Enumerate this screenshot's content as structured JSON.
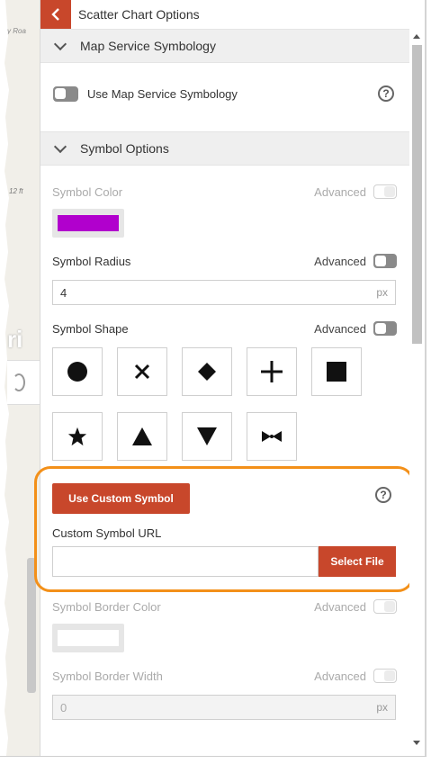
{
  "map": {
    "road_label": "y Roa",
    "feet_label": "12 ft",
    "logo_text": "ri"
  },
  "header": {
    "title": "Scatter Chart Options",
    "back_icon": "chevron-left-icon"
  },
  "sections": {
    "map_service": {
      "title": "Map Service Symbology",
      "toggle_label": "Use Map Service Symbology",
      "toggle_on": false
    },
    "symbol_options": {
      "title": "Symbol Options"
    }
  },
  "symbol_color": {
    "label": "Symbol Color",
    "advanced_label": "Advanced",
    "color": "#b100cd"
  },
  "symbol_radius": {
    "label": "Symbol Radius",
    "advanced_label": "Advanced",
    "value": "4",
    "unit": "px"
  },
  "symbol_shape": {
    "label": "Symbol Shape",
    "advanced_label": "Advanced",
    "shapes": [
      "circle",
      "x",
      "diamond",
      "cross",
      "square",
      "star",
      "triangle-up",
      "triangle-down",
      "bowtie"
    ]
  },
  "custom_symbol": {
    "button_label": "Use Custom Symbol",
    "url_label": "Custom Symbol URL",
    "url_value": "",
    "select_file_label": "Select File"
  },
  "symbol_border_color": {
    "label": "Symbol Border Color",
    "advanced_label": "Advanced",
    "color": "#ffffff"
  },
  "symbol_border_width": {
    "label": "Symbol Border Width",
    "advanced_label": "Advanced",
    "value": "0",
    "unit": "px"
  },
  "colors": {
    "accent": "#c8472b",
    "highlight": "#f39019"
  }
}
